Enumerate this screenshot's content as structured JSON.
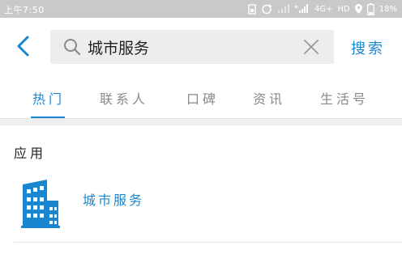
{
  "status_bar": {
    "time": "上午7:50",
    "network": "4G+",
    "hd": "HD",
    "battery": "18%"
  },
  "search": {
    "value": "城市服务",
    "action_label": "搜索"
  },
  "tabs": [
    {
      "label": "热门",
      "active": true
    },
    {
      "label": "联系人",
      "active": false
    },
    {
      "label": "口碑",
      "active": false
    },
    {
      "label": "资讯",
      "active": false
    },
    {
      "label": "生活号",
      "active": false
    }
  ],
  "section": {
    "title": "应用"
  },
  "apps": [
    {
      "name": "城市服务",
      "icon": "building-icon"
    }
  ],
  "colors": {
    "accent": "#1a86d0",
    "status_bar": "#c9c9c9",
    "search_bg": "#ededed"
  }
}
